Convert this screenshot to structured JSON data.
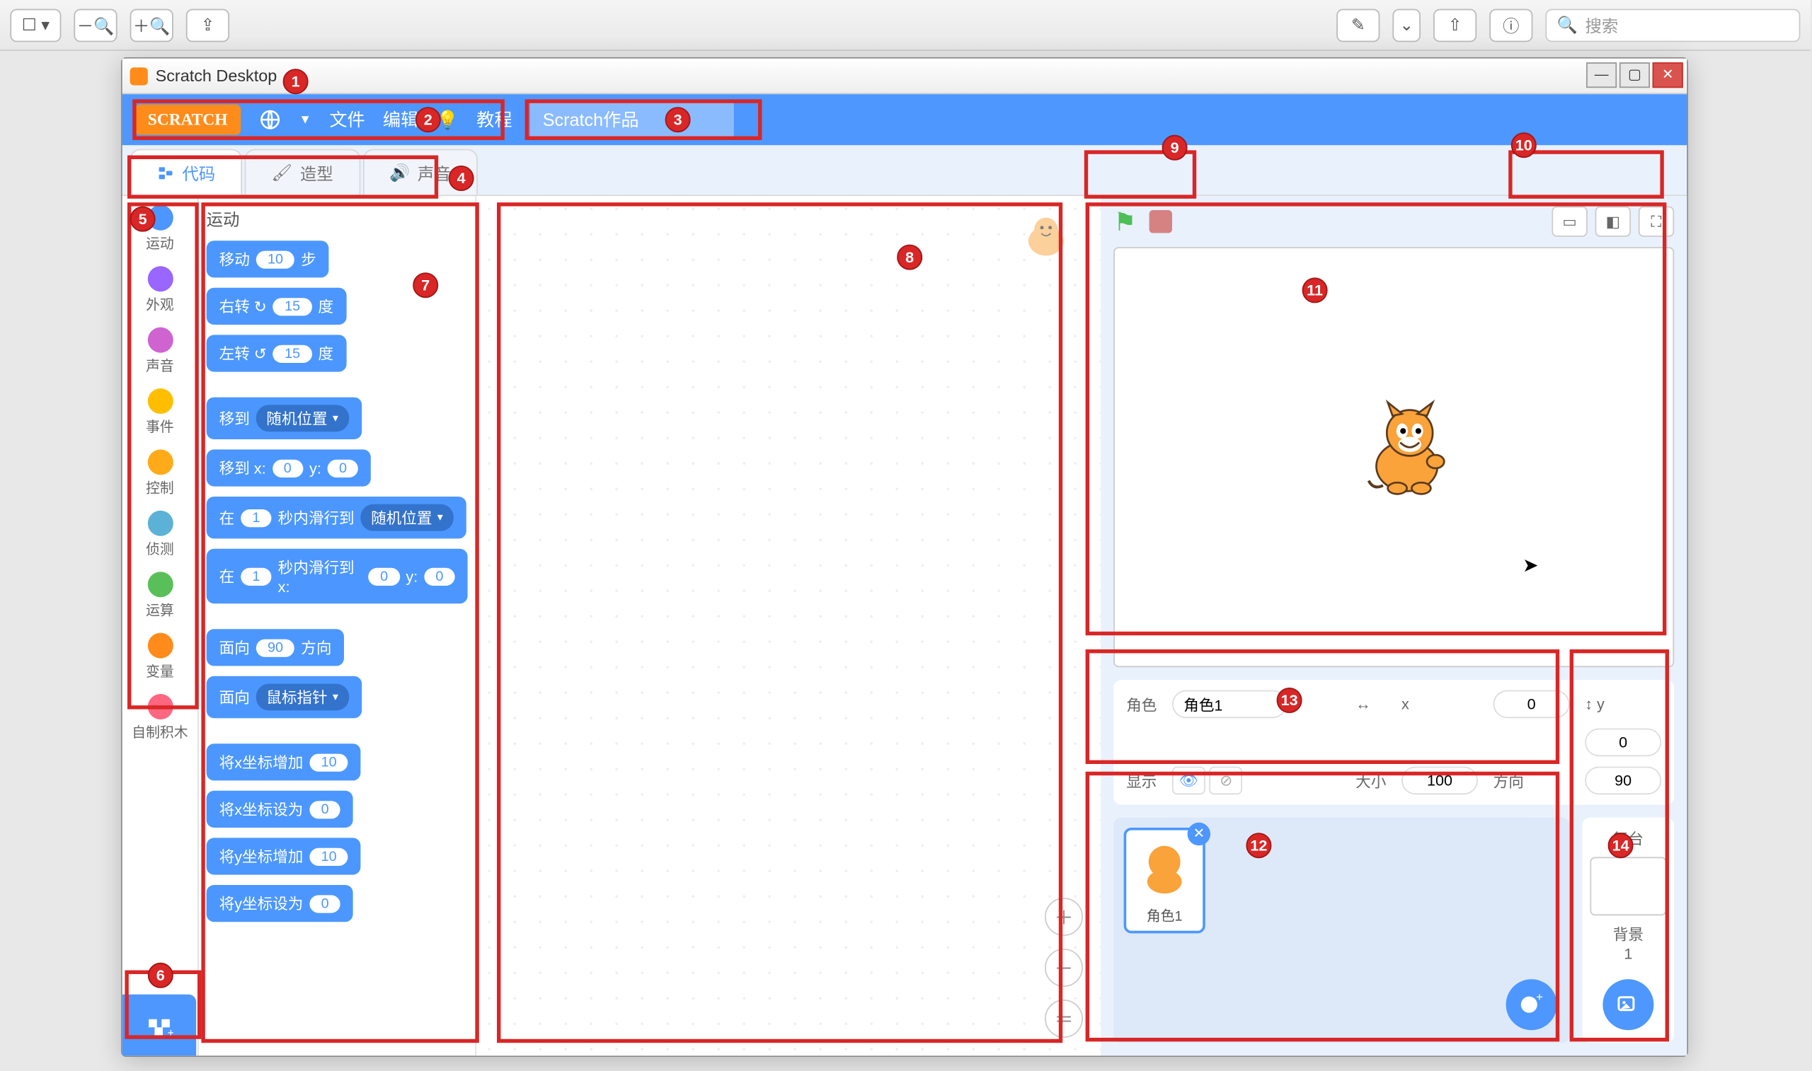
{
  "mac_toolbar": {
    "search_placeholder": "搜索"
  },
  "app": {
    "title": "Scratch Desktop",
    "menubar": {
      "logo": "SCRATCH",
      "file": "文件",
      "edit": "编辑",
      "tutorials": "教程",
      "project_name": "Scratch作品"
    },
    "tabs": {
      "code": "代码",
      "costumes": "造型",
      "sounds": "声音"
    },
    "categories": [
      {
        "label": "运动",
        "color": "#4c97ff"
      },
      {
        "label": "外观",
        "color": "#9966ff"
      },
      {
        "label": "声音",
        "color": "#cf63cf"
      },
      {
        "label": "事件",
        "color": "#ffbf00"
      },
      {
        "label": "控制",
        "color": "#ffab19"
      },
      {
        "label": "侦测",
        "color": "#5cb1d6"
      },
      {
        "label": "运算",
        "color": "#59c059"
      },
      {
        "label": "变量",
        "color": "#ff8c1a"
      },
      {
        "label": "自制积木",
        "color": "#ff6680"
      }
    ],
    "palette_header": "运动",
    "blocks": {
      "move": {
        "pre": "移动",
        "val": "10",
        "suf": "步"
      },
      "turn_cw": {
        "pre": "右转 ↻",
        "val": "15",
        "suf": "度"
      },
      "turn_ccw": {
        "pre": "左转 ↺",
        "val": "15",
        "suf": "度"
      },
      "goto_drop": {
        "pre": "移到",
        "drop": "随机位置"
      },
      "goto_xy": {
        "pre": "移到 x:",
        "x": "0",
        "mid": "y:",
        "y": "0"
      },
      "glide_drop": {
        "pre": "在",
        "sec": "1",
        "mid": "秒内滑行到",
        "drop": "随机位置"
      },
      "glide_xy": {
        "pre": "在",
        "sec": "1",
        "mid": "秒内滑行到 x:",
        "x": "0",
        "mid2": "y:",
        "y": "0"
      },
      "point_dir": {
        "pre": "面向",
        "val": "90",
        "suf": "方向"
      },
      "point_towards": {
        "pre": "面向",
        "drop": "鼠标指针"
      },
      "change_x": {
        "pre": "将x坐标增加",
        "val": "10"
      },
      "set_x": {
        "pre": "将x坐标设为",
        "val": "0"
      },
      "change_y": {
        "pre": "将y坐标增加",
        "val": "10"
      },
      "set_y": {
        "pre": "将y坐标设为",
        "val": "0"
      }
    },
    "sprite_info": {
      "label_sprite": "角色",
      "sprite_name": "角色1",
      "x_label": "x",
      "x_val": "0",
      "y_label": "y",
      "y_val": "0",
      "show_label": "显示",
      "size_label": "大小",
      "size_val": "100",
      "dir_label": "方向",
      "dir_val": "90"
    },
    "sprite_card_name": "角色1",
    "stage_panel": {
      "title": "舞台",
      "backdrops_label": "背景",
      "backdrops_count": "1"
    }
  },
  "annotations": [
    "1",
    "2",
    "3",
    "4",
    "5",
    "6",
    "7",
    "8",
    "9",
    "10",
    "11",
    "12",
    "13",
    "14"
  ]
}
